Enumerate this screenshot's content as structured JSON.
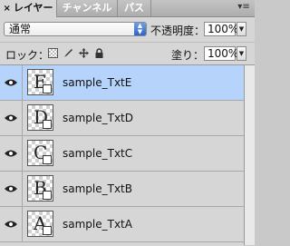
{
  "tabs": [
    {
      "label": "レイヤー",
      "active": true
    },
    {
      "label": "チャンネル",
      "active": false
    },
    {
      "label": "パス",
      "active": false
    }
  ],
  "close_glyph": "×",
  "blend": {
    "value": "通常"
  },
  "opacity": {
    "label": "不透明度：",
    "value": "100%"
  },
  "lock": {
    "label": "ロック：",
    "icons": [
      "lock-transparency-icon",
      "lock-image-icon",
      "lock-position-icon",
      "lock-all-icon"
    ]
  },
  "fill": {
    "label": "塗り：",
    "value": "100%"
  },
  "layers": [
    {
      "name": "sample_TxtE",
      "glyph": "E",
      "selected": true
    },
    {
      "name": "sample_TxtD",
      "glyph": "D",
      "selected": false
    },
    {
      "name": "sample_TxtC",
      "glyph": "C",
      "selected": false
    },
    {
      "name": "sample_TxtB",
      "glyph": "B",
      "selected": false
    },
    {
      "name": "sample_TxtA",
      "glyph": "A",
      "selected": false
    }
  ],
  "colors": {
    "selected_row": "#b5d3fb",
    "panel": "#d6d6d6",
    "spin_accent": "#2d64c9"
  }
}
